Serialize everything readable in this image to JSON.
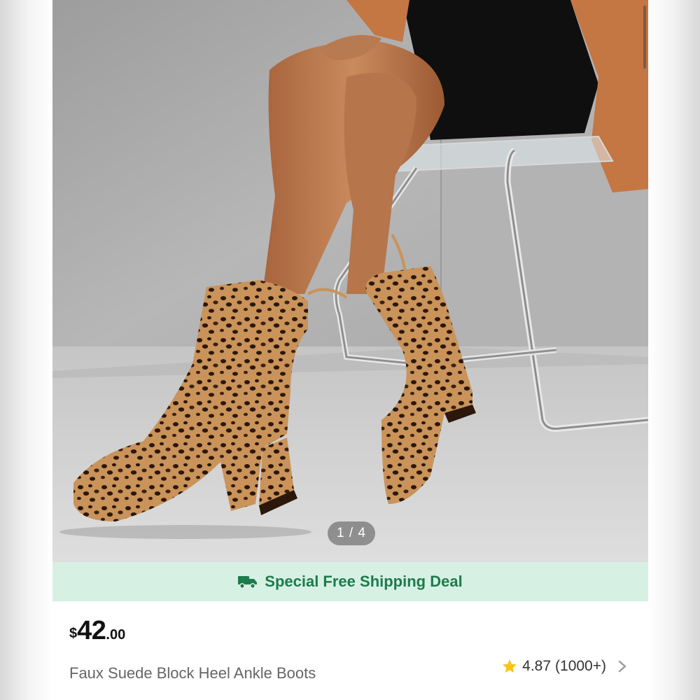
{
  "gallery": {
    "image_alt": "Leopard print faux suede block heel ankle boots",
    "pager": "1 / 4"
  },
  "shipping_banner": {
    "icon": "truck-icon",
    "text": "Special Free Shipping Deal",
    "colors": {
      "background": "#d6f1e3",
      "text": "#1f7a4d"
    }
  },
  "product": {
    "price": {
      "currency": "$",
      "amount": "42",
      "cents": ".00"
    },
    "title": "Faux Suede Block Heel Ankle Boots",
    "rating": {
      "score": "4.87",
      "count": "(1000+)",
      "icon": "star-icon",
      "star_color": "#f5c518"
    }
  }
}
